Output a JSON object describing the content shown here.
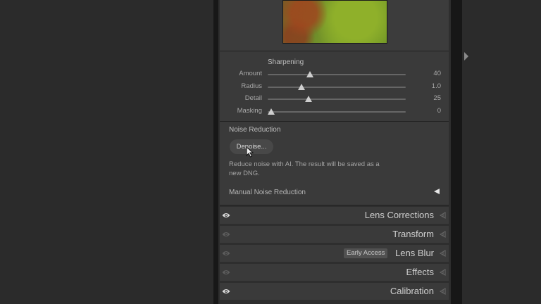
{
  "detail": {
    "sharpening": {
      "title": "Sharpening",
      "sliders": [
        {
          "label": "Amount",
          "value": "40",
          "position": 0.28
        },
        {
          "label": "Radius",
          "value": "1.0",
          "position": 0.22
        },
        {
          "label": "Detail",
          "value": "25",
          "position": 0.27
        },
        {
          "label": "Masking",
          "value": "0",
          "position": 0.0
        }
      ]
    },
    "noise_reduction": {
      "title": "Noise Reduction",
      "denoise_label": "Denoise...",
      "description": "Reduce noise with AI. The result will be saved as a new DNG.",
      "manual_label": "Manual Noise Reduction"
    }
  },
  "panels": [
    {
      "title": "Lens Corrections",
      "eye_visible": true,
      "badge": ""
    },
    {
      "title": "Transform",
      "eye_visible": false,
      "badge": ""
    },
    {
      "title": "Lens Blur",
      "eye_visible": false,
      "badge": "Early Access"
    },
    {
      "title": "Effects",
      "eye_visible": false,
      "badge": ""
    },
    {
      "title": "Calibration",
      "eye_visible": true,
      "badge": ""
    }
  ],
  "colors": {
    "panel_bg": "#3a3a3a",
    "app_bg": "#2b2b2b",
    "eye_active": "#e0e0e0",
    "eye_inactive": "#5e5e5e"
  },
  "icons": {
    "eye": "eye-icon",
    "panel_toggle": "triangle-left-icon",
    "cursor": "cursor-icon"
  }
}
